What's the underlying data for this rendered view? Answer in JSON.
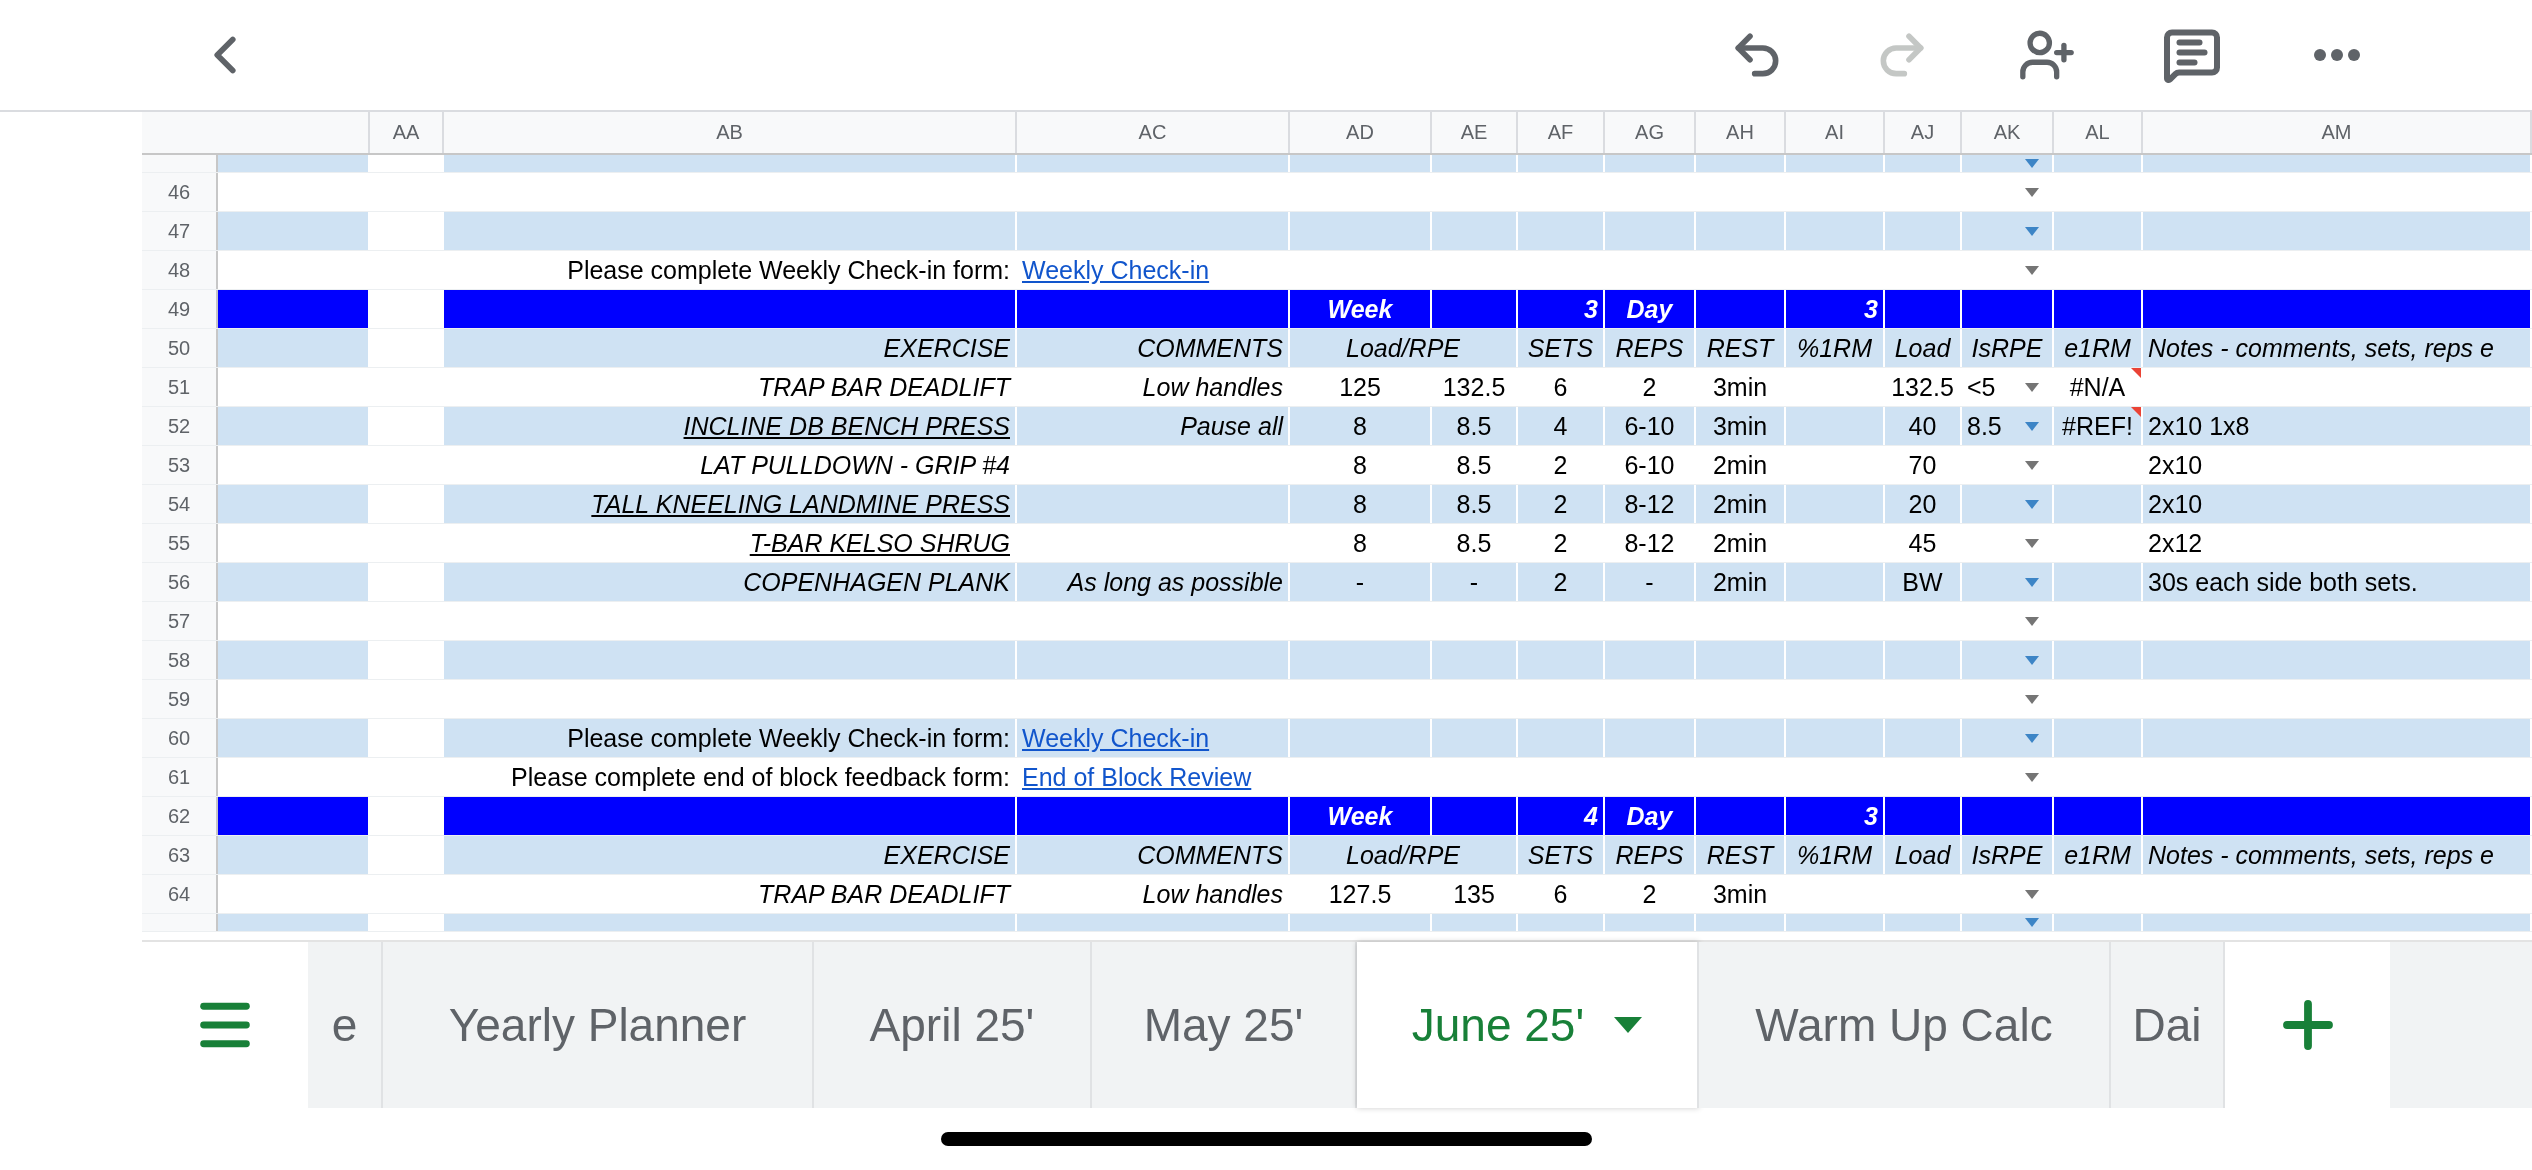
{
  "toolbar": {
    "undo_disabled": false,
    "redo_disabled": true
  },
  "columns": [
    "AA",
    "AB",
    "AC",
    "AD",
    "AE",
    "AF",
    "AG",
    "AH",
    "AI",
    "AJ",
    "AK",
    "AL",
    "AM"
  ],
  "rows": [
    {
      "kind": "blank",
      "shaded": true,
      "partial": true
    },
    {
      "number": "46",
      "kind": "blank",
      "shaded": false
    },
    {
      "number": "47",
      "kind": "blank",
      "shaded": true
    },
    {
      "number": "48",
      "kind": "link",
      "shaded": false,
      "prompt": "Please complete Weekly Check-in form:",
      "link": "Weekly Check-in"
    },
    {
      "number": "49",
      "kind": "week_header",
      "week_label": "Week",
      "week": "3",
      "day_label": "Day",
      "day": "3"
    },
    {
      "number": "50",
      "kind": "columns",
      "shaded": true,
      "labels": [
        "EXERCISE",
        "COMMENTS",
        "Load/RPE",
        "SETS",
        "REPS",
        "REST",
        "%1RM",
        "Load",
        "IsRPE",
        "e1RM",
        "Notes - comments, sets, reps e"
      ]
    },
    {
      "number": "51",
      "kind": "exercise",
      "shaded": false,
      "exercise": "TRAP BAR DEADLIFT",
      "underlined": false,
      "comments": "Low handles",
      "load_rpe_1": "125",
      "load_rpe_2": "132.5",
      "sets": "6",
      "reps": "2",
      "rest": "3min",
      "load": "132.5",
      "is_rpe": "<5",
      "e1rm": "#N/A",
      "e1rm_flag": true
    },
    {
      "number": "52",
      "kind": "exercise",
      "shaded": true,
      "exercise": "INCLINE DB BENCH PRESS",
      "underlined": true,
      "comments": "Pause all",
      "load_rpe_1": "8",
      "load_rpe_2": "8.5",
      "sets": "4",
      "reps": "6-10",
      "rest": "3min",
      "load": "40",
      "is_rpe": "8.5",
      "e1rm": "#REF!",
      "e1rm_flag": true,
      "notes": "2x10 1x8"
    },
    {
      "number": "53",
      "kind": "exercise",
      "shaded": false,
      "exercise": "LAT PULLDOWN - GRIP #4",
      "underlined": false,
      "load_rpe_1": "8",
      "load_rpe_2": "8.5",
      "sets": "2",
      "reps": "6-10",
      "rest": "2min",
      "load": "70",
      "notes": "2x10"
    },
    {
      "number": "54",
      "kind": "exercise",
      "shaded": true,
      "exercise": "TALL KNEELING LANDMINE PRESS",
      "underlined": true,
      "load_rpe_1": "8",
      "load_rpe_2": "8.5",
      "sets": "2",
      "reps": "8-12",
      "rest": "2min",
      "load": "20",
      "notes": "2x10"
    },
    {
      "number": "55",
      "kind": "exercise",
      "shaded": false,
      "exercise": "T-BAR KELSO SHRUG",
      "underlined": true,
      "load_rpe_1": "8",
      "load_rpe_2": "8.5",
      "sets": "2",
      "reps": "8-12",
      "rest": "2min",
      "load": "45",
      "notes": "2x12"
    },
    {
      "number": "56",
      "kind": "exercise",
      "shaded": true,
      "exercise": "COPENHAGEN PLANK",
      "underlined": false,
      "comments": "As long as possible",
      "load_rpe_1": "-",
      "load_rpe_2": "-",
      "sets": "2",
      "reps": "-",
      "rest": "2min",
      "load": "BW",
      "notes": "30s each side both sets."
    },
    {
      "number": "57",
      "kind": "blank",
      "shaded": false
    },
    {
      "number": "58",
      "kind": "blank",
      "shaded": true
    },
    {
      "number": "59",
      "kind": "blank",
      "shaded": false
    },
    {
      "number": "60",
      "kind": "link",
      "shaded": true,
      "prompt": "Please complete Weekly Check-in form:",
      "link": "Weekly Check-in"
    },
    {
      "number": "61",
      "kind": "link",
      "shaded": false,
      "prompt": "Please complete end of block feedback form:",
      "link": "End of Block Review"
    },
    {
      "number": "62",
      "kind": "week_header",
      "week_label": "Week",
      "week": "4",
      "day_label": "Day",
      "day": "3"
    },
    {
      "number": "63",
      "kind": "columns",
      "shaded": true,
      "labels": [
        "EXERCISE",
        "COMMENTS",
        "Load/RPE",
        "SETS",
        "REPS",
        "REST",
        "%1RM",
        "Load",
        "IsRPE",
        "e1RM",
        "Notes - comments, sets, reps e"
      ]
    },
    {
      "number": "64",
      "kind": "exercise",
      "shaded": false,
      "exercise": "TRAP BAR DEADLIFT",
      "underlined": false,
      "comments": "Low handles",
      "load_rpe_1": "127.5",
      "load_rpe_2": "135",
      "sets": "6",
      "reps": "2",
      "rest": "3min"
    },
    {
      "kind": "blank",
      "shaded": true,
      "partial": true
    }
  ],
  "tabs": [
    {
      "label": "e",
      "selected": false
    },
    {
      "label": "Yearly Planner",
      "selected": false
    },
    {
      "label": "April 25'",
      "selected": false
    },
    {
      "label": "May 25'",
      "selected": false
    },
    {
      "label": "June 25'",
      "selected": true
    },
    {
      "label": "Warm Up Calc",
      "selected": false
    },
    {
      "label": "Dai",
      "selected": false
    }
  ]
}
